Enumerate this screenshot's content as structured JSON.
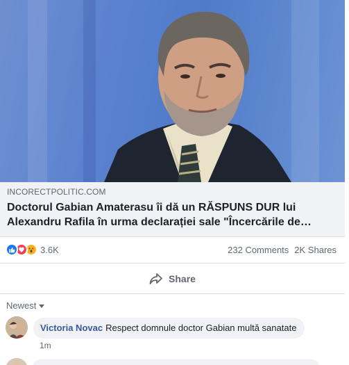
{
  "link": {
    "domain": "INCORECTPOLITIC.COM",
    "title": "Doctorul Gabian Amaterasu îi dă un RĂSPUNS DUR lui Alexandru Rafila în urma declarației sale \"Încercările de…"
  },
  "stats": {
    "reaction_icons": [
      "like-icon",
      "love-icon",
      "wow-icon"
    ],
    "reaction_count": "3.6K",
    "comments": "232 Comments",
    "shares": "2K Shares"
  },
  "actions": {
    "share_label": "Share",
    "share_icon": "share-arrow-icon"
  },
  "comments": {
    "sort_label": "Newest",
    "items": [
      {
        "author": "Victoria Novac",
        "text": "Respect domnule doctor Gabian multă sanatate",
        "time": "1m"
      }
    ]
  },
  "colors": {
    "like": "#1877f2",
    "love": "#f33e58",
    "wow": "#f7b125",
    "author_link": "#385898",
    "muted": "#606770",
    "caption_bg": "#f0f2f5"
  }
}
